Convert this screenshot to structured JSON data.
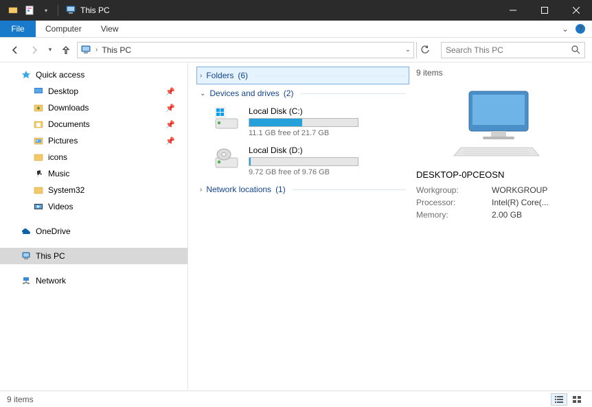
{
  "titlebar": {
    "title": "This PC"
  },
  "ribbon": {
    "file": "File",
    "tabs": [
      "Computer",
      "View"
    ]
  },
  "nav": {
    "crumb": "This PC"
  },
  "search": {
    "placeholder": "Search This PC"
  },
  "sidebar": {
    "quickAccess": "Quick access",
    "items": [
      {
        "label": "Desktop",
        "pinned": true
      },
      {
        "label": "Downloads",
        "pinned": true
      },
      {
        "label": "Documents",
        "pinned": true
      },
      {
        "label": "Pictures",
        "pinned": true
      },
      {
        "label": "icons",
        "pinned": false
      },
      {
        "label": "Music",
        "pinned": false
      },
      {
        "label": "System32",
        "pinned": false
      },
      {
        "label": "Videos",
        "pinned": false
      }
    ],
    "onedrive": "OneDrive",
    "thispc": "This PC",
    "network": "Network"
  },
  "groups": {
    "folders": {
      "label": "Folders",
      "count": "(6)"
    },
    "devices": {
      "label": "Devices and drives",
      "count": "(2)"
    },
    "network": {
      "label": "Network locations",
      "count": "(1)"
    }
  },
  "drives": [
    {
      "name": "Local Disk (C:)",
      "free": "11.1 GB free of 21.7 GB",
      "fillPct": 49
    },
    {
      "name": "Local Disk (D:)",
      "free": "9.72 GB free of 9.76 GB",
      "fillPct": 1
    }
  ],
  "details": {
    "count": "9 items",
    "computerName": "DESKTOP-0PCEOSN",
    "rows": [
      {
        "k": "Workgroup:",
        "v": "WORKGROUP"
      },
      {
        "k": "Processor:",
        "v": "Intel(R) Core(..."
      },
      {
        "k": "Memory:",
        "v": "2.00 GB"
      }
    ]
  },
  "status": {
    "text": "9 items"
  }
}
